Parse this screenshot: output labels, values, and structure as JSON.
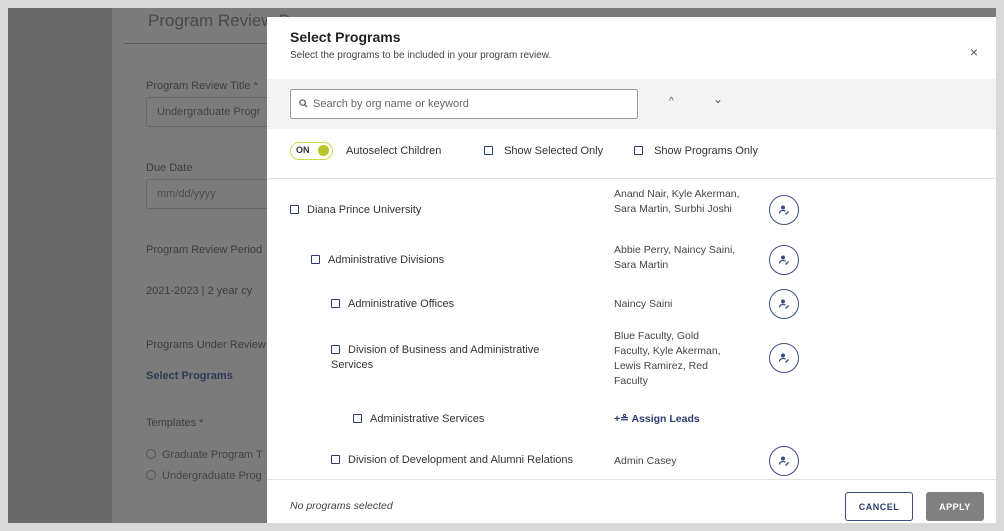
{
  "background": {
    "page_title": "Program Review D",
    "title_label": "Program Review Title *",
    "title_value": "Undergraduate Progr",
    "due_date_label": "Due Date",
    "due_date_placeholder": "mm/dd/yyyy",
    "period_label": "Program Review Period",
    "period_value": "2021-2023 | 2 year cy",
    "programs_label": "Programs Under Review",
    "select_programs_link": "Select Programs",
    "templates_label": "Templates *",
    "template_options": [
      "Graduate Program T",
      "Undergraduate Prog"
    ]
  },
  "modal": {
    "title": "Select Programs",
    "subtitle": "Select the programs to be included in your program review.",
    "close_icon": "×",
    "search": {
      "placeholder": "Search by org name or keyword",
      "up_arrow": "^",
      "down_arrow": "⌄"
    },
    "options": {
      "toggle_label": "ON",
      "autoselect_label": "Autoselect Children",
      "show_selected_label": "Show Selected Only",
      "show_programs_label": "Show Programs Only"
    },
    "rows": [
      {
        "name": "Diana Prince University",
        "leads": "Anand Nair, Kyle Akerman, Sara Martin, Surbhi Joshi"
      },
      {
        "name": "Administrative Divisions",
        "leads": "Abbie Perry, Naincy Saini, Sara Martin"
      },
      {
        "name": "Administrative Offices",
        "leads": "Naincy Saini"
      },
      {
        "name": "Division of Business and Administrative Services",
        "leads": "Blue Faculty, Gold Faculty, Kyle Akerman, Lewis Ramirez, Red Faculty"
      },
      {
        "name": "Administrative Services",
        "assign_label": "Assign Leads"
      },
      {
        "name": "Division of Development and Alumni Relations",
        "leads": "Admin Casey"
      }
    ],
    "footer": {
      "status": "No programs selected",
      "cancel_label": "CANCEL",
      "apply_label": "APPLY"
    }
  }
}
